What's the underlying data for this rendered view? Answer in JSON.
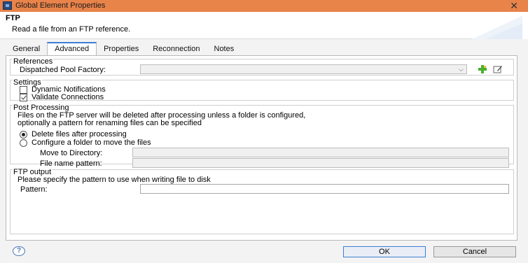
{
  "window": {
    "title": "Global Element Properties",
    "close_glyph": "✕"
  },
  "header": {
    "title": "FTP",
    "description": "Read a file from an FTP reference."
  },
  "tabs": [
    {
      "label": "General",
      "active": false
    },
    {
      "label": "Advanced",
      "active": true
    },
    {
      "label": "Properties",
      "active": false
    },
    {
      "label": "Reconnection",
      "active": false
    },
    {
      "label": "Notes",
      "active": false
    }
  ],
  "references": {
    "legend": "References",
    "pool_label": "Dispatched Pool Factory:",
    "pool_value": "",
    "add_icon": "add-green-plus-icon",
    "edit_icon": "edit-icon"
  },
  "settings": {
    "legend": "Settings",
    "dynamic_notifications": {
      "label": "Dynamic Notifications",
      "checked": false
    },
    "validate_connections": {
      "label": "Validate Connections",
      "checked": true
    }
  },
  "post_processing": {
    "legend": "Post Processing",
    "description_line1": "Files on the FTP server will be deleted after processing unless a folder is configured,",
    "description_line2": "optionally a pattern for renaming files can be specified",
    "delete_option": {
      "label": "Delete files after processing",
      "selected": true
    },
    "move_option": {
      "label": "Configure a folder to move the files",
      "selected": false
    },
    "move_dir_label": "Move to Directory:",
    "move_dir_value": "",
    "file_pattern_label": "File name pattern:",
    "file_pattern_value": ""
  },
  "ftp_output": {
    "legend": "FTP output",
    "description": "Please specify the pattern to use when writing file to disk",
    "pattern_label": "Pattern:",
    "pattern_value": ""
  },
  "footer": {
    "help_glyph": "?",
    "ok_label": "OK",
    "cancel_label": "Cancel"
  },
  "colors": {
    "titlebar": "#e8834a",
    "accent": "#3c7fd6",
    "dialog_bg": "#f3f3f3"
  }
}
